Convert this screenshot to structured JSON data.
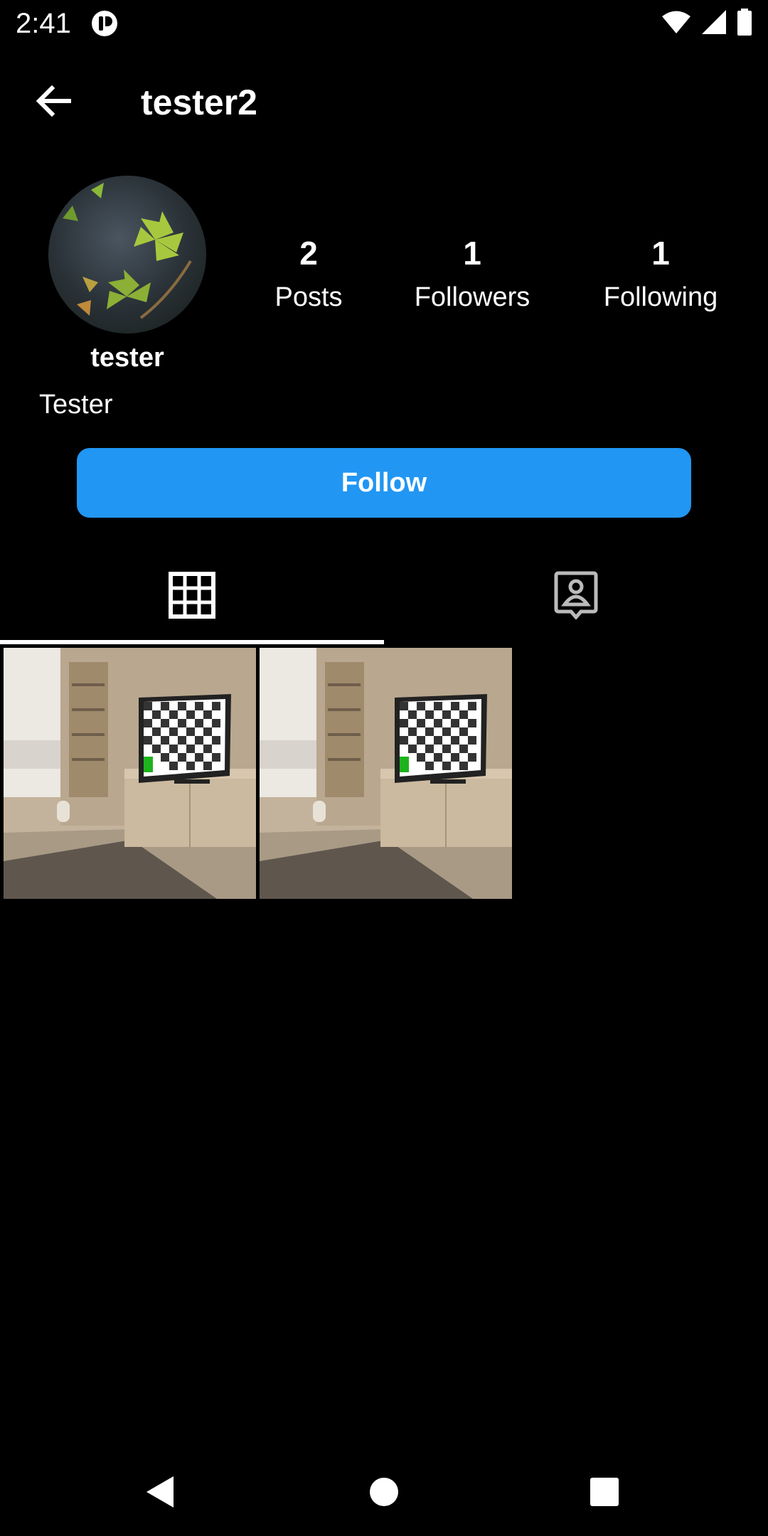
{
  "status_bar": {
    "time": "2:41",
    "icons": [
      "app-notification-icon",
      "wifi-icon",
      "cell-signal-icon",
      "battery-icon"
    ]
  },
  "header": {
    "title": "tester2",
    "back_icon": "arrow-left-icon"
  },
  "profile": {
    "display_name": "tester",
    "bio": "Tester",
    "stats": [
      {
        "value": "2",
        "label": "Posts"
      },
      {
        "value": "1",
        "label": "Followers"
      },
      {
        "value": "1",
        "label": "Following"
      }
    ],
    "follow_label": "Follow"
  },
  "tabs": [
    {
      "icon": "grid-icon",
      "selected": true
    },
    {
      "icon": "tagged-person-icon",
      "selected": false
    }
  ],
  "posts": [
    {
      "image": "room-with-tv-photo"
    },
    {
      "image": "room-with-tv-photo"
    }
  ],
  "colors": {
    "background": "#000000",
    "accent": "#2196f3",
    "text": "#ffffff"
  },
  "nav": [
    "nav-back-icon",
    "nav-home-icon",
    "nav-recents-icon"
  ]
}
